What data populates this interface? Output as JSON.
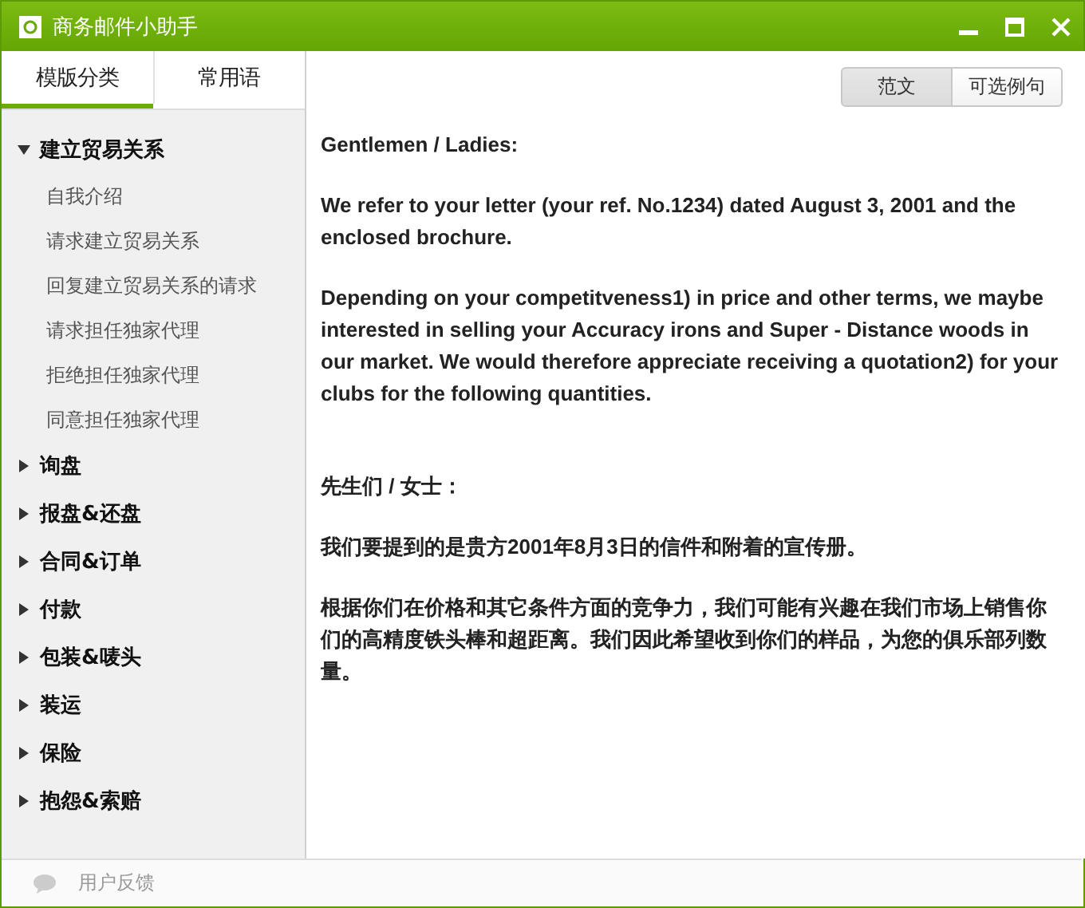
{
  "window": {
    "title": "商务邮件小助手"
  },
  "sidebar": {
    "tabs": [
      {
        "label": "模版分类",
        "selected": true
      },
      {
        "label": "常用语",
        "selected": false
      }
    ],
    "tree": [
      {
        "label": "建立贸易关系",
        "expanded": true,
        "children": [
          {
            "label": "自我介绍"
          },
          {
            "label": "请求建立贸易关系"
          },
          {
            "label": "回复建立贸易关系的请求"
          },
          {
            "label": "请求担任独家代理"
          },
          {
            "label": "拒绝担任独家代理"
          },
          {
            "label": "同意担任独家代理"
          }
        ]
      },
      {
        "label": "询盘",
        "expanded": false
      },
      {
        "label": "报盘&还盘",
        "expanded": false
      },
      {
        "label": "合同&订单",
        "expanded": false
      },
      {
        "label": "付款",
        "expanded": false
      },
      {
        "label": "包装&唛头",
        "expanded": false
      },
      {
        "label": "装运",
        "expanded": false
      },
      {
        "label": "保险",
        "expanded": false
      },
      {
        "label": "抱怨&索赔",
        "expanded": false
      }
    ],
    "feedback": "用户反馈"
  },
  "content": {
    "toggle": [
      {
        "label": "范文",
        "selected": true
      },
      {
        "label": "可选例句",
        "selected": false
      }
    ],
    "english": [
      "Gentlemen / Ladies:",
      "We refer to your letter (your ref. No.1234) dated August 3, 2001 and the enclosed brochure.",
      "Depending on your competitveness1) in price and other terms, we maybe interested in selling your Accuracy irons and Super - Distance woods in our market. We would therefore appreciate receiving a quotation2) for your clubs for the following quantities."
    ],
    "chinese": [
      "先生们 / 女士：",
      "我们要提到的是贵方2001年8月3日的信件和附着的宣传册。",
      "根据你们在价格和其它条件方面的竞争力，我们可能有兴趣在我们市场上销售你们的高精度铁头棒和超距离。我们因此希望收到你们的样品，为您的俱乐部列数量。"
    ]
  }
}
